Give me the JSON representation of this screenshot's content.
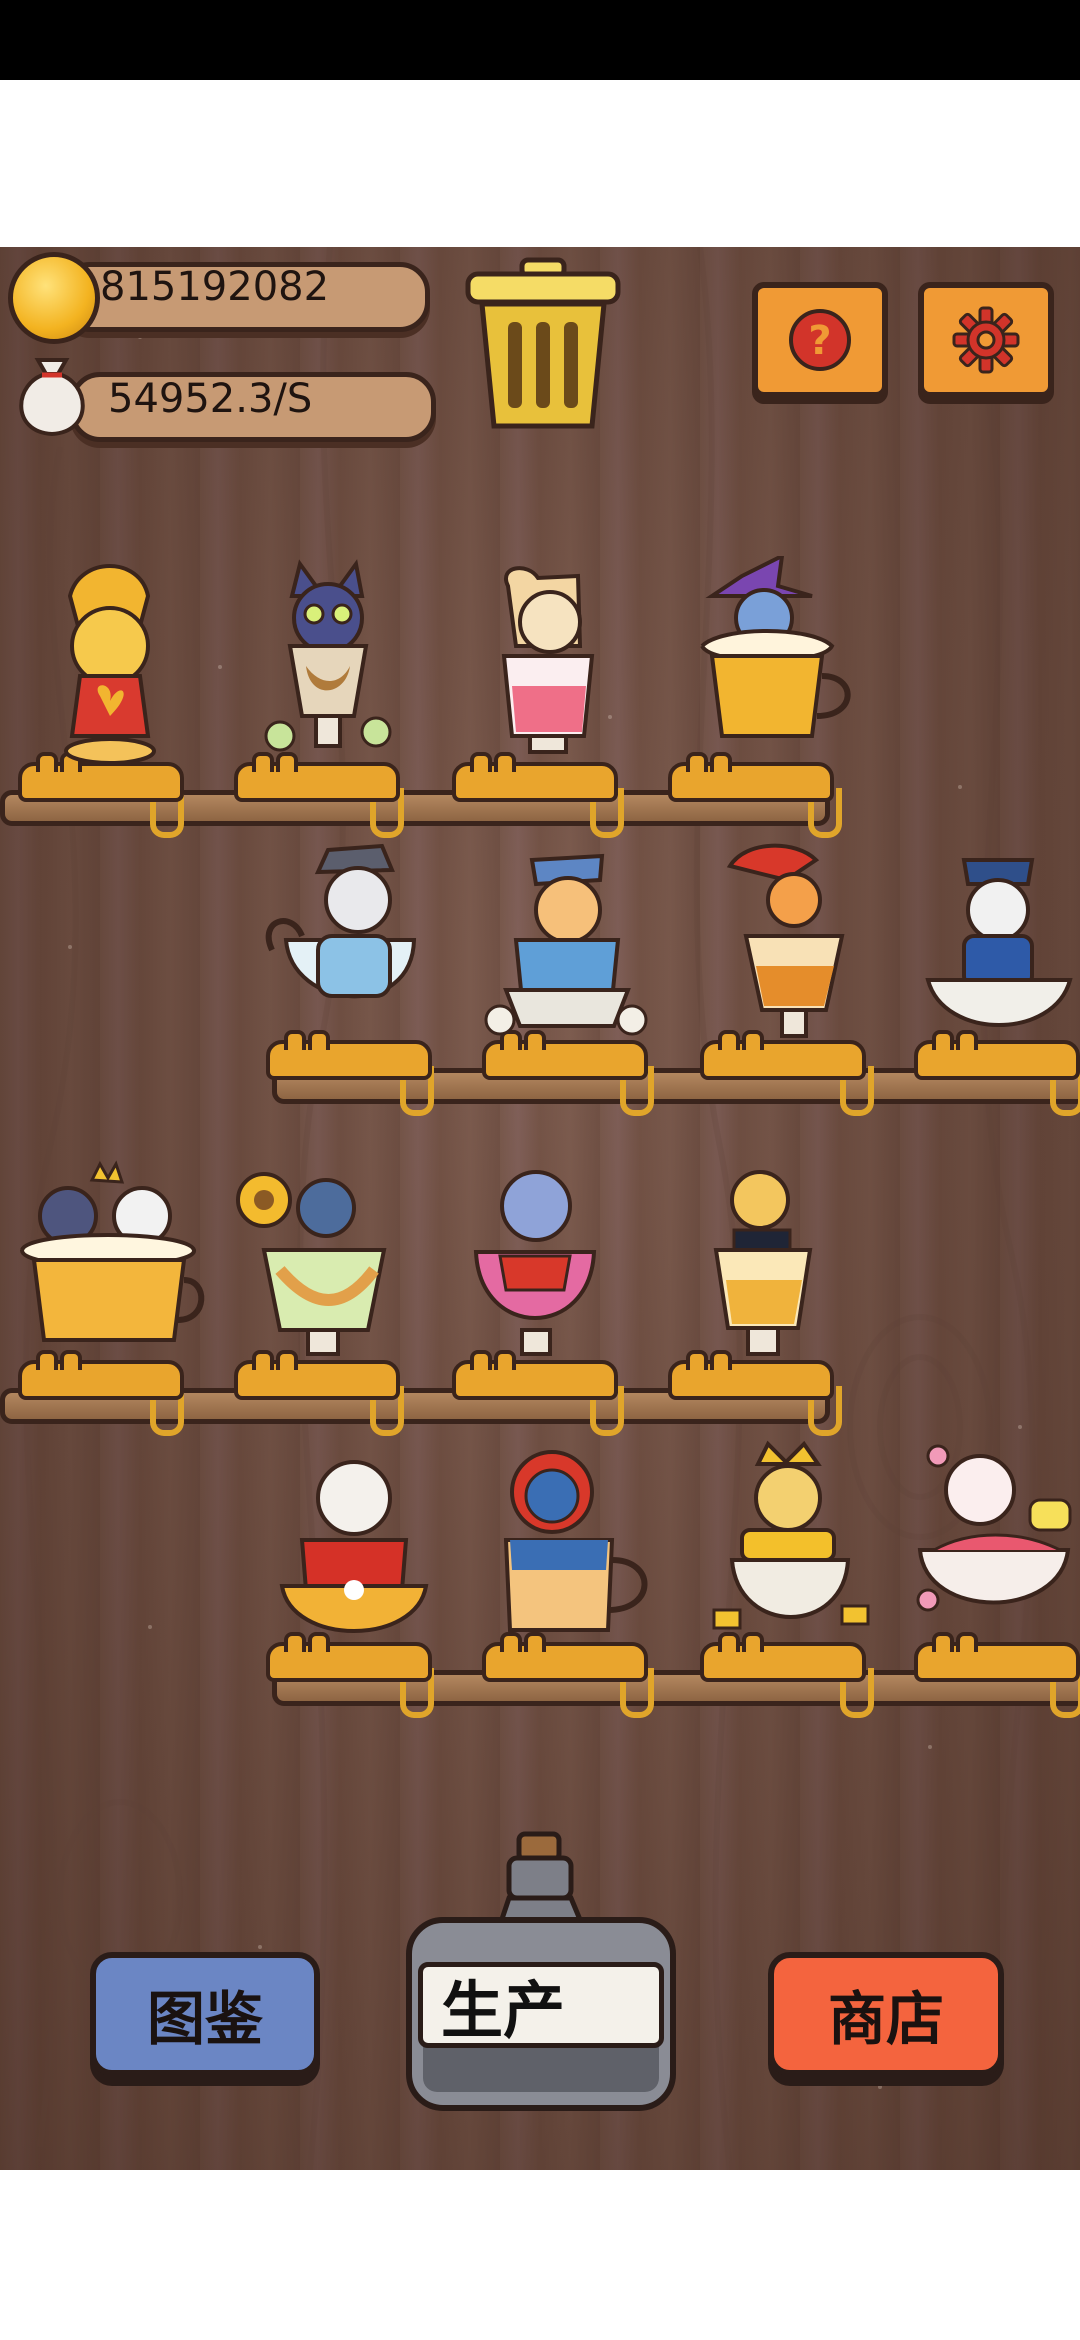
{
  "hud": {
    "coins": "815192082",
    "income_rate": "54952.3/S",
    "coin_icon": "gold-coin-icon",
    "bag_icon": "money-bag-icon",
    "trash_icon": "trash-can-icon",
    "help_icon": "question-mark-icon",
    "settings_icon": "gear-icon"
  },
  "bottom": {
    "catalog_label": "图鉴",
    "produce_label": "生产",
    "shop_label": "商店"
  },
  "colors": {
    "catalog": "#6b86c4",
    "shop": "#f4643e",
    "orange_button": "#f09a35",
    "wood": "#7a5a4d"
  },
  "shelves": [
    {
      "cats": [
        "royal-cat-icon",
        "owl-cat-icon",
        "llama-cat-icon",
        "witch-cat-icon"
      ]
    },
    {
      "cats": [
        "detective-cat-icon",
        "scholar-cat-icon",
        "pirate-cat-icon",
        "officer-cat-icon"
      ]
    },
    {
      "cats": [
        "king-cats-icon",
        "sunflower-cat-icon",
        "fancy-cat-icon",
        "gentleman-cat-icon"
      ]
    },
    {
      "cats": [
        "chef-cat-icon",
        "hooded-cat-icon",
        "emperor-cat-icon",
        "blossom-cat-icon"
      ]
    }
  ]
}
